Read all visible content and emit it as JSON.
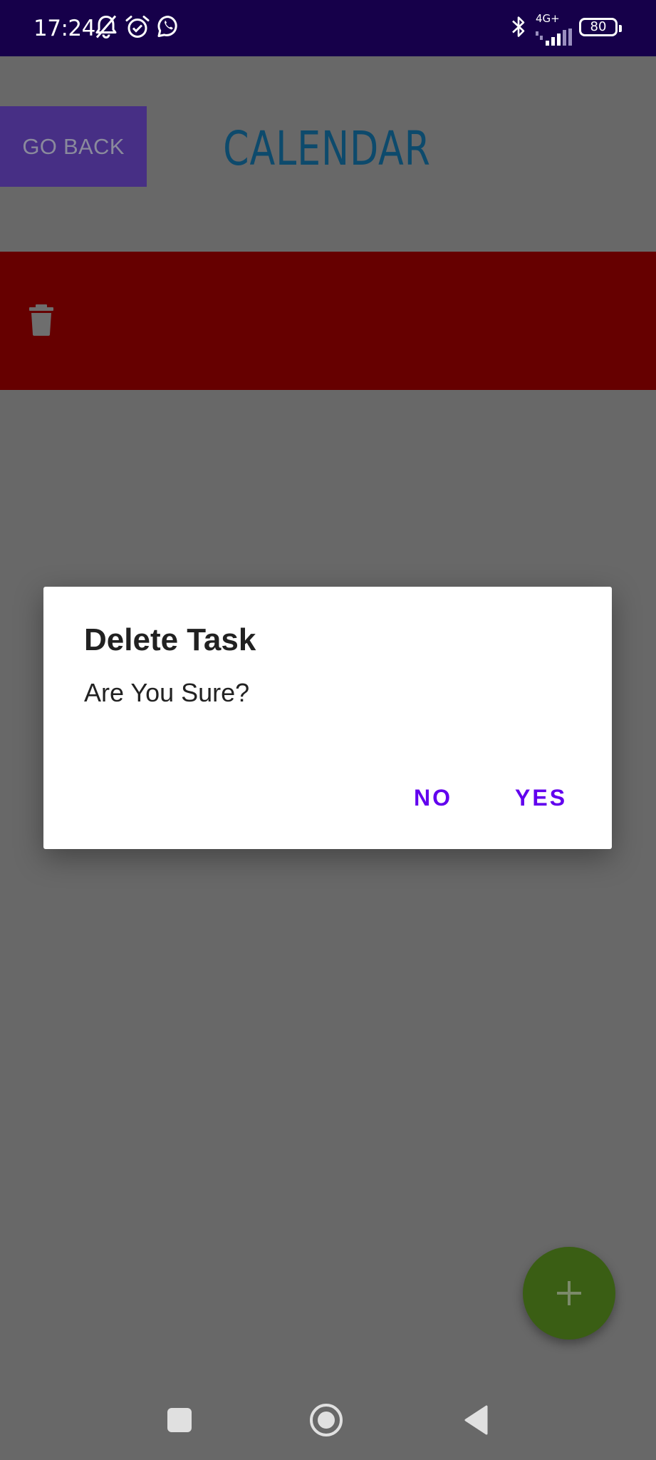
{
  "status_bar": {
    "time": "17:24",
    "network_label": "4G+",
    "battery_level": "80",
    "icons": [
      "notifications-off-icon",
      "alarm-icon",
      "whatsapp-icon",
      "bluetooth-icon",
      "signal-icon",
      "battery-icon"
    ]
  },
  "header": {
    "back_label": "GO BACK",
    "title": "CALENDAR"
  },
  "task_row": {
    "icon": "trash-icon",
    "background": "#660000"
  },
  "dialog": {
    "title": "Delete Task",
    "message": "Are You Sure?",
    "buttons": {
      "no": "NO",
      "yes": "YES"
    },
    "accent": "#6200ee"
  },
  "fab": {
    "icon": "plus-icon",
    "color": "#3a5e14"
  },
  "nav_bar": {
    "icons": [
      "recent-apps-icon",
      "home-icon",
      "back-icon"
    ]
  },
  "colors": {
    "status_bar": "#16004a",
    "scrim": "#686868",
    "go_back_button": "#472f85",
    "title": "#0d4a6c"
  }
}
